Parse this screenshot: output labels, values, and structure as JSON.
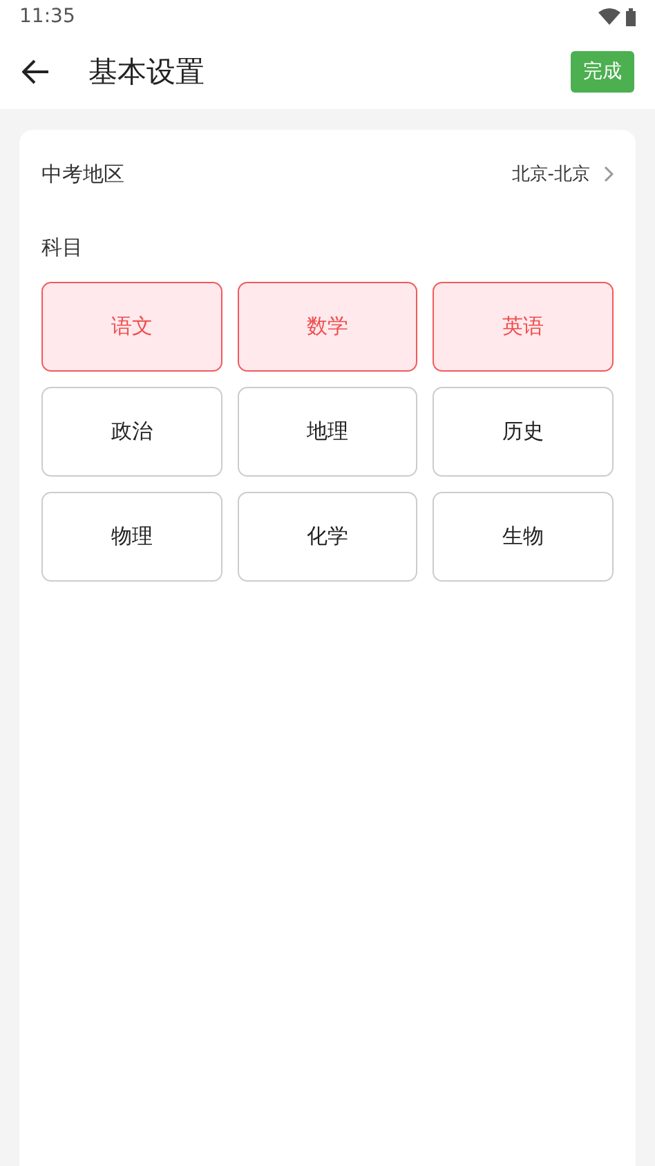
{
  "status_bar": {
    "time": "11:35"
  },
  "header": {
    "title": "基本设置",
    "done_button": "完成"
  },
  "region": {
    "label": "中考地区",
    "value": "北京-北京"
  },
  "subjects": {
    "label": "科目",
    "items": [
      {
        "name": "语文",
        "selected": true
      },
      {
        "name": "数学",
        "selected": true
      },
      {
        "name": "英语",
        "selected": true
      },
      {
        "name": "政治",
        "selected": false
      },
      {
        "name": "地理",
        "selected": false
      },
      {
        "name": "历史",
        "selected": false
      },
      {
        "name": "物理",
        "selected": false
      },
      {
        "name": "化学",
        "selected": false
      },
      {
        "name": "生物",
        "selected": false
      }
    ]
  }
}
